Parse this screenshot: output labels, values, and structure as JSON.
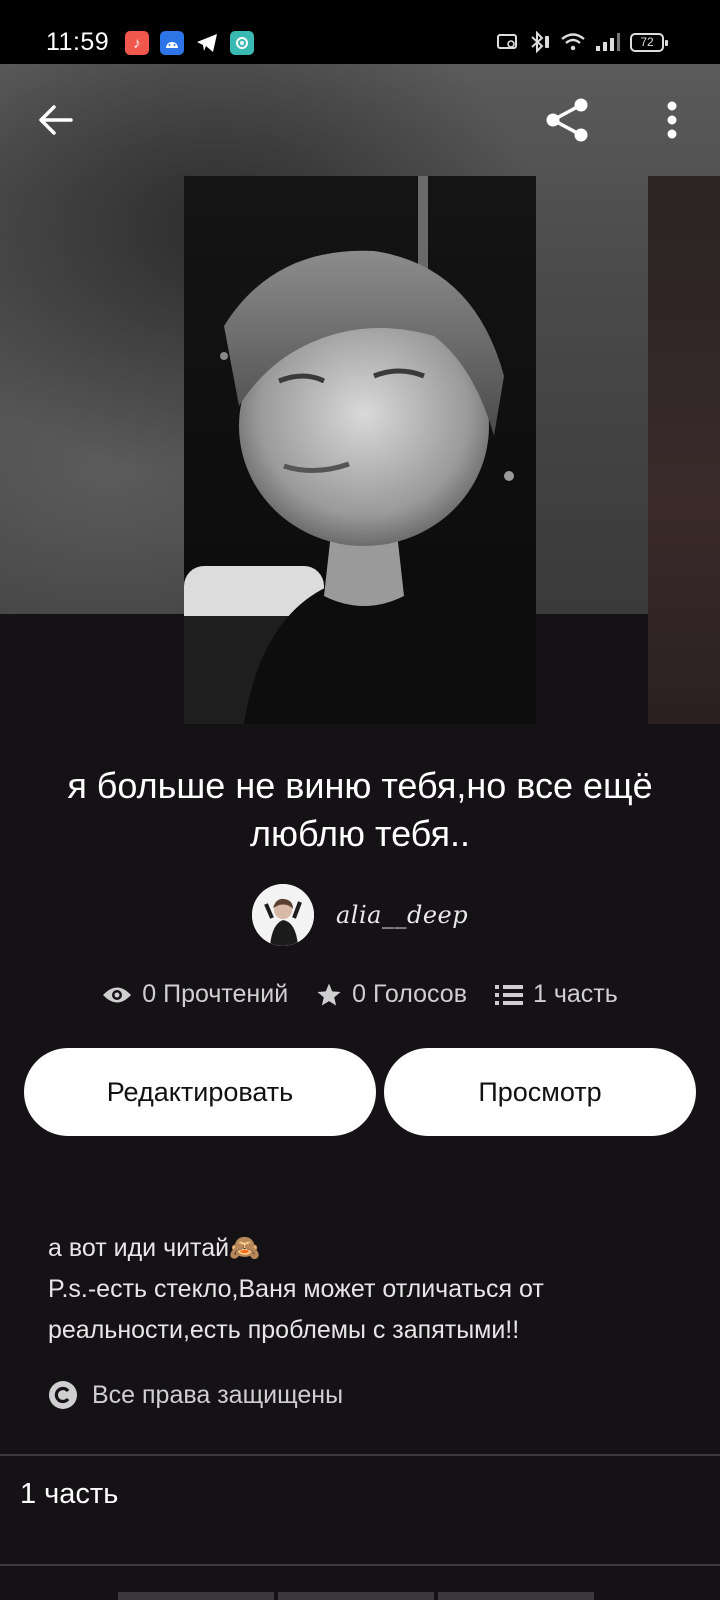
{
  "status_bar": {
    "time": "11:59",
    "battery": "72",
    "app_icons": [
      {
        "name": "music-app-icon",
        "color": "#f0584e",
        "glyph": "♪"
      },
      {
        "name": "android-app-icon",
        "color": "#2d74e6",
        "glyph": "⬒"
      },
      {
        "name": "telegram-icon",
        "color": "transparent",
        "glyph": "✈"
      },
      {
        "name": "assistant-app-icon",
        "color": "#39b9b1",
        "glyph": "◉"
      }
    ]
  },
  "story": {
    "title": "я больше не виню тебя,но все ещё люблю тебя..",
    "author": "alia__deep",
    "stats": {
      "reads": "0 Прочтений",
      "votes": "0 Голосов",
      "parts": "1 часть"
    },
    "description_lines": [
      "а вот иди читай🙈",
      "P.s.-есть стекло,Ваня может отличаться от",
      "реальности,есть проблемы с запятыми!!"
    ],
    "copyright": "Все права защищены"
  },
  "actions": {
    "edit_label": "Редактировать",
    "view_label": "Просмотр"
  },
  "parts_section": {
    "title": "1 часть"
  },
  "colors": {
    "background": "#141215",
    "button_bg": "#ffffff",
    "muted_text": "#cfcfcf"
  }
}
